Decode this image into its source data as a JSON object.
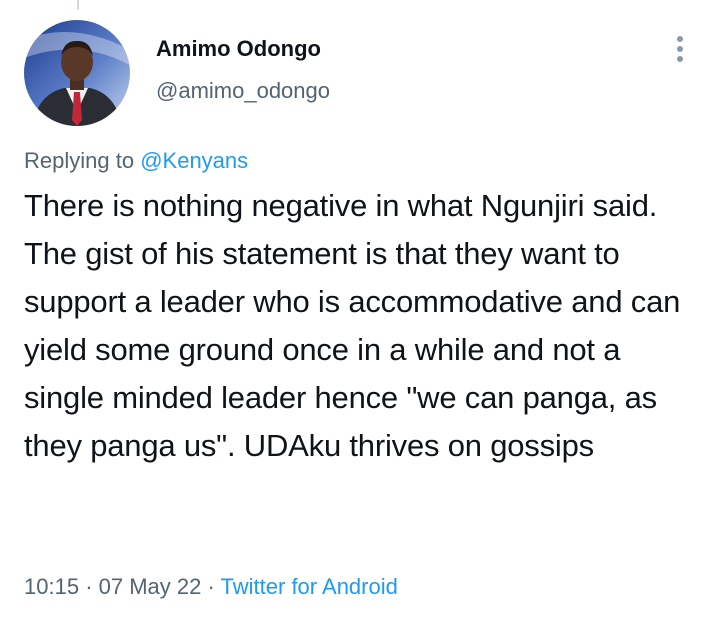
{
  "author": {
    "name": "Amimo Odongo",
    "handle": "@amimo_odongo"
  },
  "reply": {
    "prefix": "Replying to",
    "mention": "@Kenyans"
  },
  "tweet": {
    "text": "There is nothing negative in what Ngunjiri said. The gist of his statement is that they want to support a leader who is accommodative and can yield some ground once in a while and not a single minded leader hence \"we can panga, as they panga us\". UDAku thrives on gossips"
  },
  "meta": {
    "time": "10:15",
    "separator": "·",
    "date": "07 May 22",
    "source": "Twitter for Android"
  },
  "icons": {
    "more": "more-vertical-icon"
  },
  "colors": {
    "text": "#0f1419",
    "secondary": "#536471",
    "link": "#1d9bf0"
  }
}
